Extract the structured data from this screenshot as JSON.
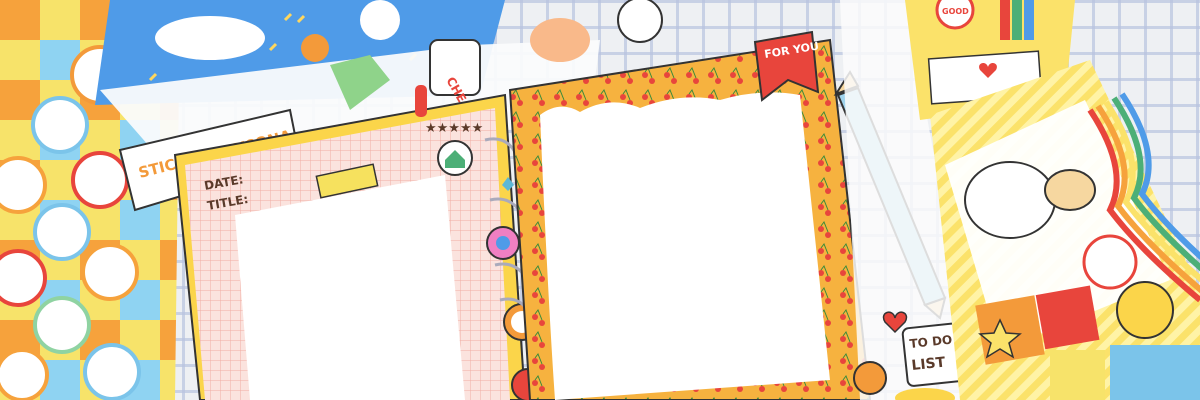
{
  "scene": {
    "description_colors": {
      "tablecloth": "#eef0f3",
      "gingham_line": "#9fb0d6",
      "paper_white": "#ffffff",
      "frame_yellow": "#fbd54a",
      "frame_orange": "#f4a73a",
      "grid_pink": "#f6c7c0",
      "sticker_blue": "#4f9be8",
      "accent_red": "#e8453c",
      "sticker_orange": "#f39a3a",
      "pencil_blue": "#9fd3ec"
    }
  },
  "texts": {
    "for_you": "FOR YOU",
    "date": "DATE:",
    "title": "TITLE:",
    "sticker_daycona": "STICKER DAYCONA",
    "todo_list_top": "TO DO",
    "todo_list_bottom": "LIST",
    "good": "GOOD",
    "che": "CHE"
  },
  "icons": [
    "house-sticker-icon",
    "tulip-sticker-icon",
    "flower-sticker-icon",
    "bunny-sticker-icon",
    "strawberry-sticker-icon",
    "heart-icon",
    "star-icon",
    "pencil-icon",
    "rainbow-icon",
    "paperclip-icon"
  ]
}
